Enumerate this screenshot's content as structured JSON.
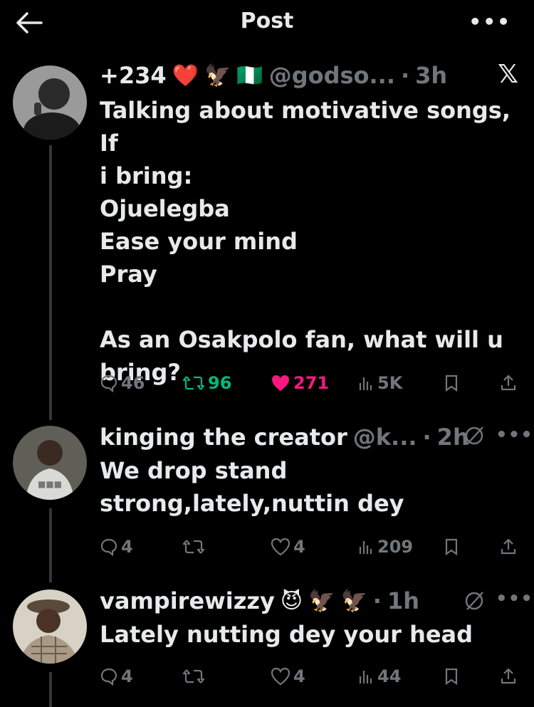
{
  "topbar": {
    "title": "Post",
    "more": "•••"
  },
  "main_post": {
    "name": "+234",
    "badges": [
      "❤️",
      "🦅",
      "🇳🇬"
    ],
    "handle": "@godso...",
    "dot": "·",
    "time": "3h",
    "platform_logo": "𝕏",
    "text": "Talking about motivative songs, If\ni bring:\nOjuelegba\nEase your mind\nPray\n\nAs an Osakpolo fan, what will u\nbring?",
    "replies": "46",
    "reposts": "96",
    "likes": "271",
    "views": "5K",
    "colors": {
      "repost": "#00ba7c",
      "like": "#f91880"
    }
  },
  "reply1": {
    "name": "kinging the creator",
    "handle": "@k...",
    "dot": "·",
    "time": "2h",
    "more": "•••",
    "text": "We drop stand\nstrong,lately,nuttin dey",
    "replies": "4",
    "likes": "4",
    "views": "209"
  },
  "reply2": {
    "name": "vampirewizzy",
    "badges": [
      "😈",
      "🦅",
      "🦅"
    ],
    "dot": "·",
    "time": "1h",
    "more": "•••",
    "text": "Lately nutting dey your head",
    "replies": "4",
    "likes": "4",
    "views": "44"
  }
}
